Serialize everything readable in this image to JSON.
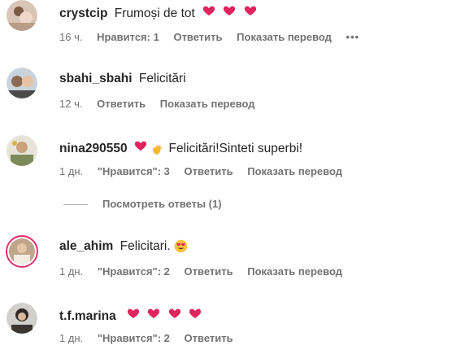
{
  "comments": [
    {
      "username": "crystcip",
      "text": "Frumoși de tot",
      "emoji": [
        "heart-icon",
        "heart-icon",
        "heart-icon"
      ],
      "time": "16 ч.",
      "likes": "Нравится: 1",
      "reply": "Ответить",
      "translate": "Показать перевод",
      "more": "•••"
    },
    {
      "username": "sbahi_sbahi",
      "text": "Felicitări",
      "time": "12 ч.",
      "reply": "Ответить",
      "translate": "Показать перевод"
    },
    {
      "username": "nina290550",
      "text": "Felicitări!Sinteti superbi!",
      "emoji": [
        "heart-icon",
        "clapping-hands-icon"
      ],
      "time": "1 дн.",
      "likes": "\"Нравится\": 3",
      "reply": "Ответить",
      "translate": "Показать перевод",
      "view_replies": "Посмотреть ответы (1)"
    },
    {
      "username": "ale_ahim",
      "text": "Felicitari.",
      "emoji": [
        "heart-eyes-icon"
      ],
      "time": "1 дн.",
      "likes": "\"Нравится\": 2",
      "reply": "Ответить",
      "translate": "Показать перевод"
    },
    {
      "username": "t.f.marina",
      "text": "",
      "emoji": [
        "heart-icon",
        "heart-icon",
        "heart-icon",
        "heart-icon"
      ],
      "time": "1 дн.",
      "likes": "\"Нравится\": 2",
      "reply": "Ответить"
    }
  ],
  "colors": {
    "heart": "#e0245e",
    "story_ring": "#e1306c",
    "meta_text": "#737373"
  }
}
